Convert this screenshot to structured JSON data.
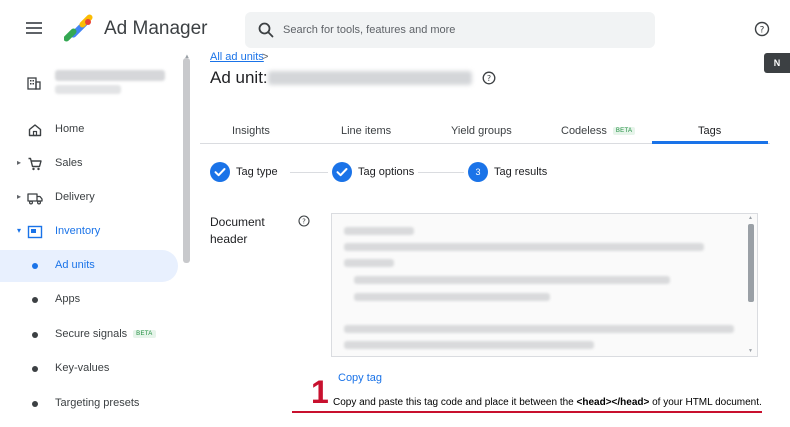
{
  "app": {
    "name": "Ad Manager",
    "search_placeholder": "Search for tools, features and more",
    "edge_tab_label": "N"
  },
  "sidebar": {
    "items": [
      {
        "label": "Home"
      },
      {
        "label": "Sales"
      },
      {
        "label": "Delivery"
      },
      {
        "label": "Inventory"
      }
    ],
    "inventory_sub": [
      {
        "label": "Ad units"
      },
      {
        "label": "Apps"
      },
      {
        "label": "Secure signals",
        "badge": "BETA"
      },
      {
        "label": "Key-values"
      },
      {
        "label": "Targeting presets"
      }
    ]
  },
  "main": {
    "breadcrumb": "All ad units",
    "breadcrumb_sep": ">",
    "title_prefix": "Ad unit:",
    "tabs": [
      {
        "label": "Insights"
      },
      {
        "label": "Line items"
      },
      {
        "label": "Yield groups"
      },
      {
        "label": "Codeless",
        "badge": "BETA"
      },
      {
        "label": "Tags"
      }
    ],
    "steps": [
      {
        "label": "Tag type",
        "state": "done"
      },
      {
        "label": "Tag options",
        "state": "done"
      },
      {
        "label": "Tag results",
        "number": "3",
        "state": "current"
      }
    ],
    "document_header_label": "Document header",
    "copy_tag": "Copy tag"
  },
  "annotation": {
    "number": "1",
    "text_before": "Copy and paste this tag code and place it between the ",
    "text_bold": "<head></head>",
    "text_after": " of your HTML document."
  },
  "colors": {
    "accent": "#1a73e8",
    "annotation_red": "#c8102e",
    "beta_green": "#1e8e3e"
  }
}
